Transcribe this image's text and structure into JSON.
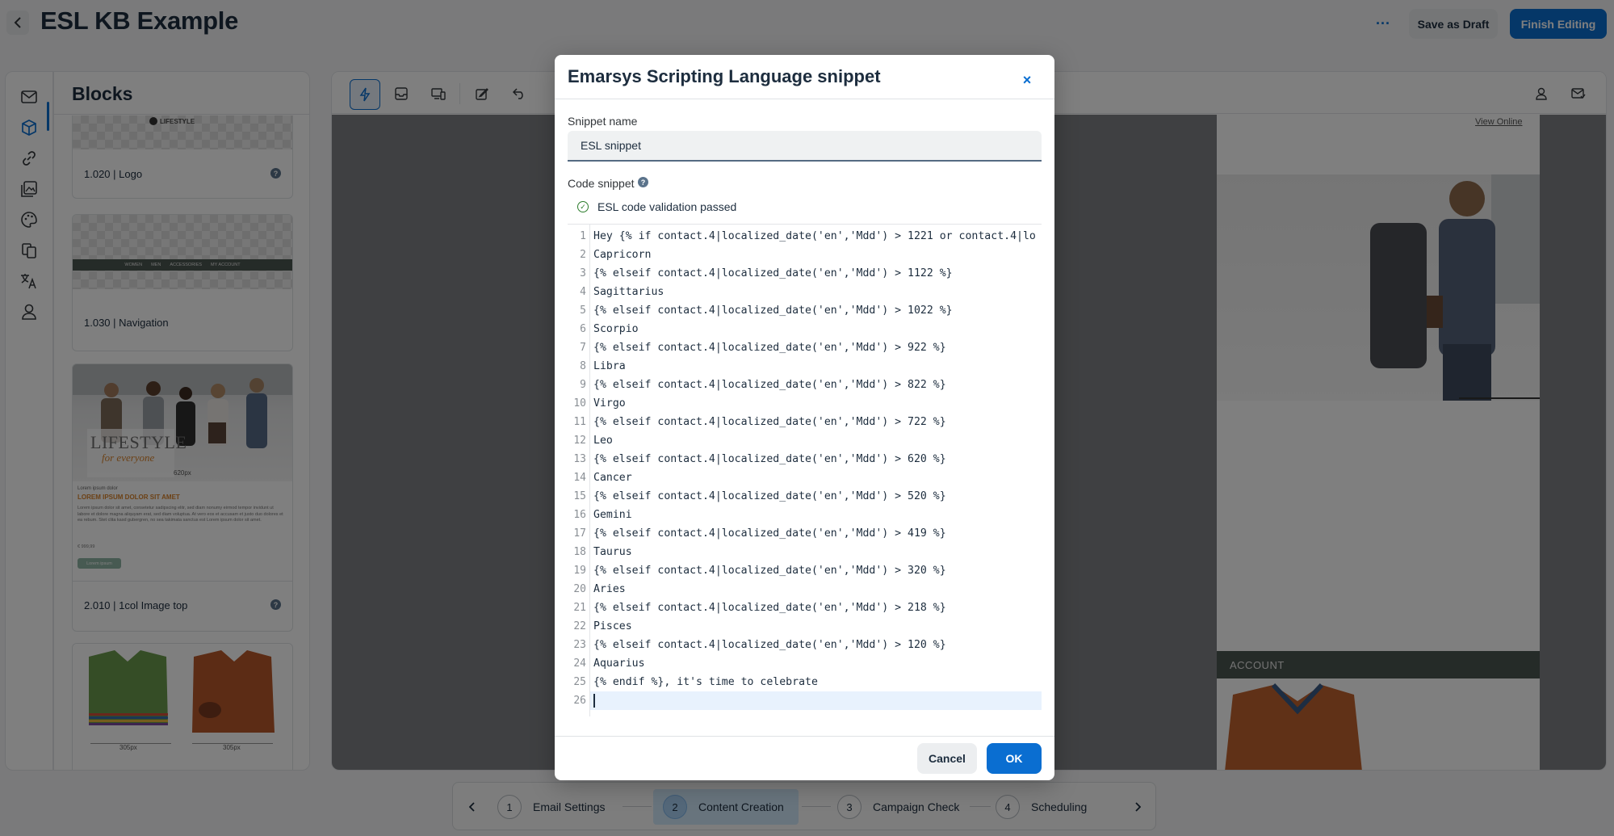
{
  "header": {
    "back_icon": "chevron-left-icon",
    "title": "ESL KB Example",
    "more_label": "···",
    "save_draft_label": "Save as Draft",
    "finish_label": "Finish Editing"
  },
  "rail": {
    "items": [
      {
        "icon": "envelope-icon"
      },
      {
        "icon": "cube-icon",
        "active": true
      },
      {
        "icon": "link-icon"
      },
      {
        "icon": "images-icon"
      },
      {
        "icon": "palette-icon"
      },
      {
        "icon": "copy-icon"
      },
      {
        "icon": "translate-icon"
      },
      {
        "icon": "user-icon"
      }
    ]
  },
  "blocks": {
    "title": "Blocks",
    "cards": [
      {
        "label": "1.020 | Logo",
        "logo_text": "LIFESTYLE"
      },
      {
        "label": "1.030 | Navigation",
        "nav_items": [
          "WOMEN",
          "MEN",
          "ACCESSORIES",
          "MY ACCOUNT"
        ]
      },
      {
        "label": "2.010 | 1col Image top",
        "image_title": "LIFESTYLE",
        "image_subtitle": "for everyone",
        "image_size": "620px",
        "eyebrow": "Lorem ipsum dolor",
        "headline": "LOREM IPSUM DOLOR SIT AMET",
        "body": "Lorem ipsum dolor sit amet, consetetur sadipscing elitr, sed diam nonumy eirmod tempor invidunt ut labore et dolore magna aliquyam erat, sed diam voluptua. At vero eos et accusam et justo duo dolores et ea rebum. Stet clita kasd gubergren, no sea takimata sanctus est Lorem ipsum dolor sit amet.",
        "price_label": "€ 999,99",
        "button_text": "Lorem ipsum"
      },
      {
        "label": "",
        "sizes": [
          "305px",
          "305px"
        ]
      }
    ]
  },
  "canvas": {
    "view_online": "View Online",
    "nav_text": "ACCOUNT"
  },
  "dialog": {
    "title": "Emarsys Scripting Language snippet",
    "close_label": "×",
    "snippet_name_label": "Snippet name",
    "snippet_name_value": "ESL snippet",
    "code_label": "Code snippet",
    "validation_text": "ESL code validation passed",
    "code_lines": [
      "Hey {% if contact.4|localized_date('en','Mdd') > 1221 or contact.4|lo",
      "Capricorn",
      "{% elseif contact.4|localized_date('en','Mdd') > 1122 %}",
      "Sagittarius",
      "{% elseif contact.4|localized_date('en','Mdd') > 1022 %}",
      "Scorpio",
      "{% elseif contact.4|localized_date('en','Mdd') > 922 %}",
      "Libra",
      "{% elseif contact.4|localized_date('en','Mdd') > 822 %}",
      "Virgo",
      "{% elseif contact.4|localized_date('en','Mdd') > 722 %}",
      "Leo",
      "{% elseif contact.4|localized_date('en','Mdd') > 620 %}",
      "Cancer",
      "{% elseif contact.4|localized_date('en','Mdd') > 520 %}",
      "Gemini",
      "{% elseif contact.4|localized_date('en','Mdd') > 419 %}",
      "Taurus",
      "{% elseif contact.4|localized_date('en','Mdd') > 320 %}",
      "Aries",
      "{% elseif contact.4|localized_date('en','Mdd') > 218 %}",
      "Pisces",
      "{% elseif contact.4|localized_date('en','Mdd') > 120 %}",
      "Aquarius",
      "{% endif %}, it's time to celebrate",
      ""
    ],
    "cancel_label": "Cancel",
    "ok_label": "OK"
  },
  "steps": {
    "prev_icon": "chevron-left-icon",
    "next_icon": "chevron-right-icon",
    "items": [
      {
        "number": "1",
        "label": "Email Settings"
      },
      {
        "number": "2",
        "label": "Content Creation",
        "active": true
      },
      {
        "number": "3",
        "label": "Campaign Check"
      },
      {
        "number": "4",
        "label": "Scheduling"
      }
    ]
  },
  "colors": {
    "accent": "#0a6ed1",
    "success": "#2b7c2b",
    "headline_orange": "#d9822b",
    "current_line": "#e8f2fd"
  }
}
